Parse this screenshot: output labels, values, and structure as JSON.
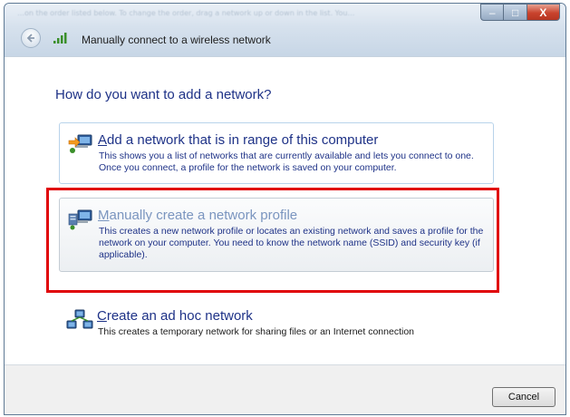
{
  "window": {
    "faded_instructions": "…on the order listed below. To change the order, drag a network up or down in the list. You…",
    "title": "Manually connect to a wireless network",
    "controls": {
      "minimize": "–",
      "maximize": "□",
      "close": "X"
    }
  },
  "main": {
    "heading": "How do you want to add a network?",
    "options": [
      {
        "title_underline_char": "A",
        "title_rest": "dd a network that is in range of this computer",
        "description": "This shows you a list of networks that are currently available and lets you connect to one. Once you connect, a profile for the network is saved on your computer."
      },
      {
        "title_underline_char": "M",
        "title_rest": "anually create a network profile",
        "description": "This creates a new network profile or locates an existing network and saves a profile for the network on your computer. You need to know the network name (SSID) and security key (if applicable)."
      },
      {
        "title_underline_char": "C",
        "title_rest": "reate an ad hoc network",
        "description": "This creates a temporary network for sharing files or an Internet connection"
      }
    ]
  },
  "footer": {
    "cancel_label": "Cancel"
  },
  "colors": {
    "link_blue": "#1e3287",
    "highlight_red": "#e0050a",
    "title_bar": "#c7d6e6"
  },
  "icons": [
    "back-arrow-icon",
    "wireless-signal-icon",
    "network-add-icon",
    "network-manual-icon",
    "adhoc-network-icon"
  ]
}
